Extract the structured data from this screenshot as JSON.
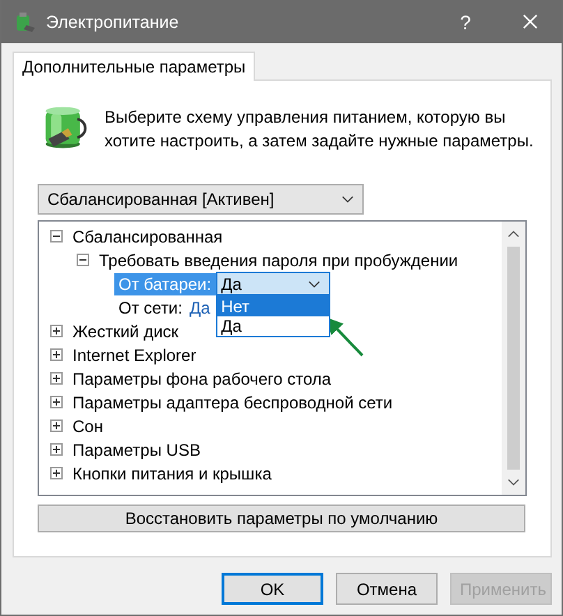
{
  "window": {
    "title": "Электропитание",
    "help": "?"
  },
  "tabs": [
    {
      "label": "Дополнительные параметры",
      "selected": true
    }
  ],
  "intro": "Выберите схему управления питанием, которую вы хотите настроить, а затем задайте нужные параметры.",
  "scheme_select": {
    "value": "Сбалансированная [Активен]"
  },
  "tree": [
    {
      "label": "Сбалансированная",
      "expanded": true,
      "children": [
        {
          "label": "Требовать введения пароля при пробуждении",
          "expanded": true,
          "settings": [
            {
              "label": "От батареи:",
              "value": "Да",
              "selected": true,
              "options": [
                {
                  "label": "Нет",
                  "highlighted": true
                },
                {
                  "label": "Да",
                  "highlighted": false
                }
              ]
            },
            {
              "label": "От сети:",
              "value": "Да",
              "selected": false
            }
          ]
        }
      ]
    },
    {
      "label": "Жесткий диск",
      "expanded": false
    },
    {
      "label": "Internet Explorer",
      "expanded": false
    },
    {
      "label": "Параметры фона рабочего стола",
      "expanded": false
    },
    {
      "label": "Параметры адаптера беспроводной сети",
      "expanded": false
    },
    {
      "label": "Сон",
      "expanded": false
    },
    {
      "label": "Параметры USB",
      "expanded": false
    },
    {
      "label": "Кнопки питания и крышка",
      "expanded": false
    }
  ],
  "restore_button": "Восстановить параметры по умолчанию",
  "buttons": [
    {
      "label": "OK",
      "default": true,
      "disabled": false
    },
    {
      "label": "Отмена",
      "default": false,
      "disabled": false
    },
    {
      "label": "Применить",
      "default": false,
      "disabled": true
    }
  ]
}
